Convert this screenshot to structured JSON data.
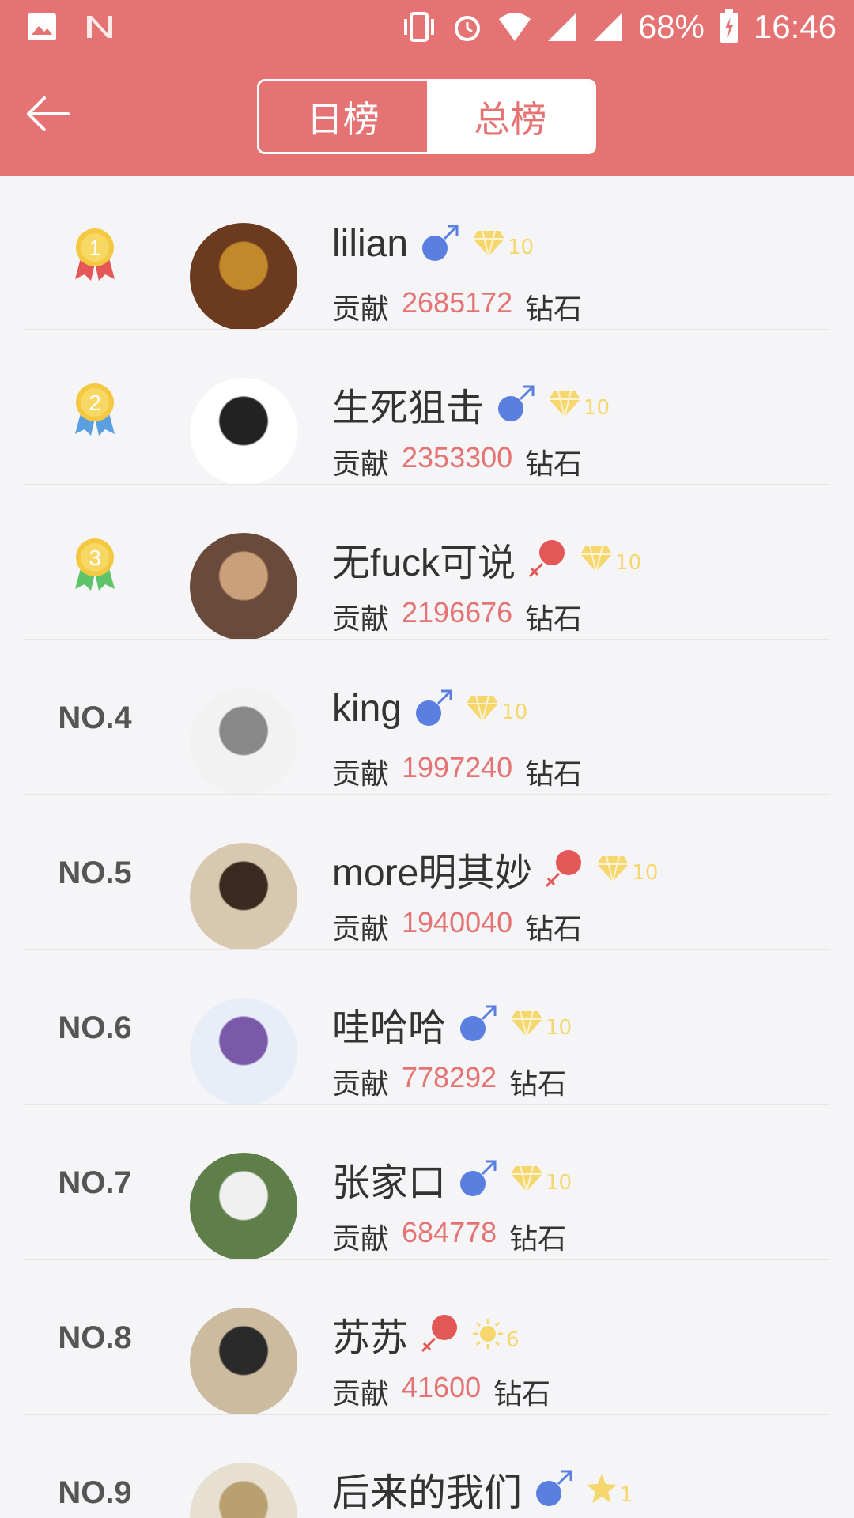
{
  "status_bar": {
    "battery": "68%",
    "time": "16:46"
  },
  "header": {
    "back_icon": "back-arrow-icon",
    "tabs": [
      {
        "label": "日榜",
        "active": true
      },
      {
        "label": "总榜",
        "active": false
      }
    ]
  },
  "colors": {
    "accent": "#e57373",
    "male": "#5b7fe0",
    "female": "#e35757",
    "level": "#f5d76e",
    "value": "#e57373"
  },
  "contrib_label": "贡献",
  "unit_label": "钻石",
  "rows": [
    {
      "rank_label": "1",
      "rank_type": "medal",
      "medal_color": "gold",
      "name": "lilian",
      "gender": "male",
      "level_icon": "diamond-icon",
      "level": "10",
      "value": "2685172"
    },
    {
      "rank_label": "2",
      "rank_type": "medal",
      "medal_color": "blue",
      "name": "生死狙击",
      "gender": "male",
      "level_icon": "diamond-icon",
      "level": "10",
      "value": "2353300"
    },
    {
      "rank_label": "3",
      "rank_type": "medal",
      "medal_color": "green",
      "name": "无fuck可说",
      "gender": "female",
      "level_icon": "diamond-icon",
      "level": "10",
      "value": "2196676"
    },
    {
      "rank_label": "NO.4",
      "rank_type": "text",
      "name": "king",
      "gender": "male",
      "level_icon": "diamond-icon",
      "level": "10",
      "value": "1997240"
    },
    {
      "rank_label": "NO.5",
      "rank_type": "text",
      "name": "more明其妙",
      "gender": "female",
      "level_icon": "diamond-icon",
      "level": "10",
      "value": "1940040"
    },
    {
      "rank_label": "NO.6",
      "rank_type": "text",
      "name": "哇哈哈",
      "gender": "male",
      "level_icon": "diamond-icon",
      "level": "10",
      "value": "778292"
    },
    {
      "rank_label": "NO.7",
      "rank_type": "text",
      "name": "张家口",
      "gender": "male",
      "level_icon": "diamond-icon",
      "level": "10",
      "value": "684778"
    },
    {
      "rank_label": "NO.8",
      "rank_type": "text",
      "name": "苏苏",
      "gender": "female",
      "level_icon": "sun-icon",
      "level": "6",
      "value": "41600"
    },
    {
      "rank_label": "NO.9",
      "rank_type": "text",
      "name": "后来的我们",
      "gender": "male",
      "level_icon": "star-icon",
      "level": "1",
      "value": ""
    }
  ]
}
